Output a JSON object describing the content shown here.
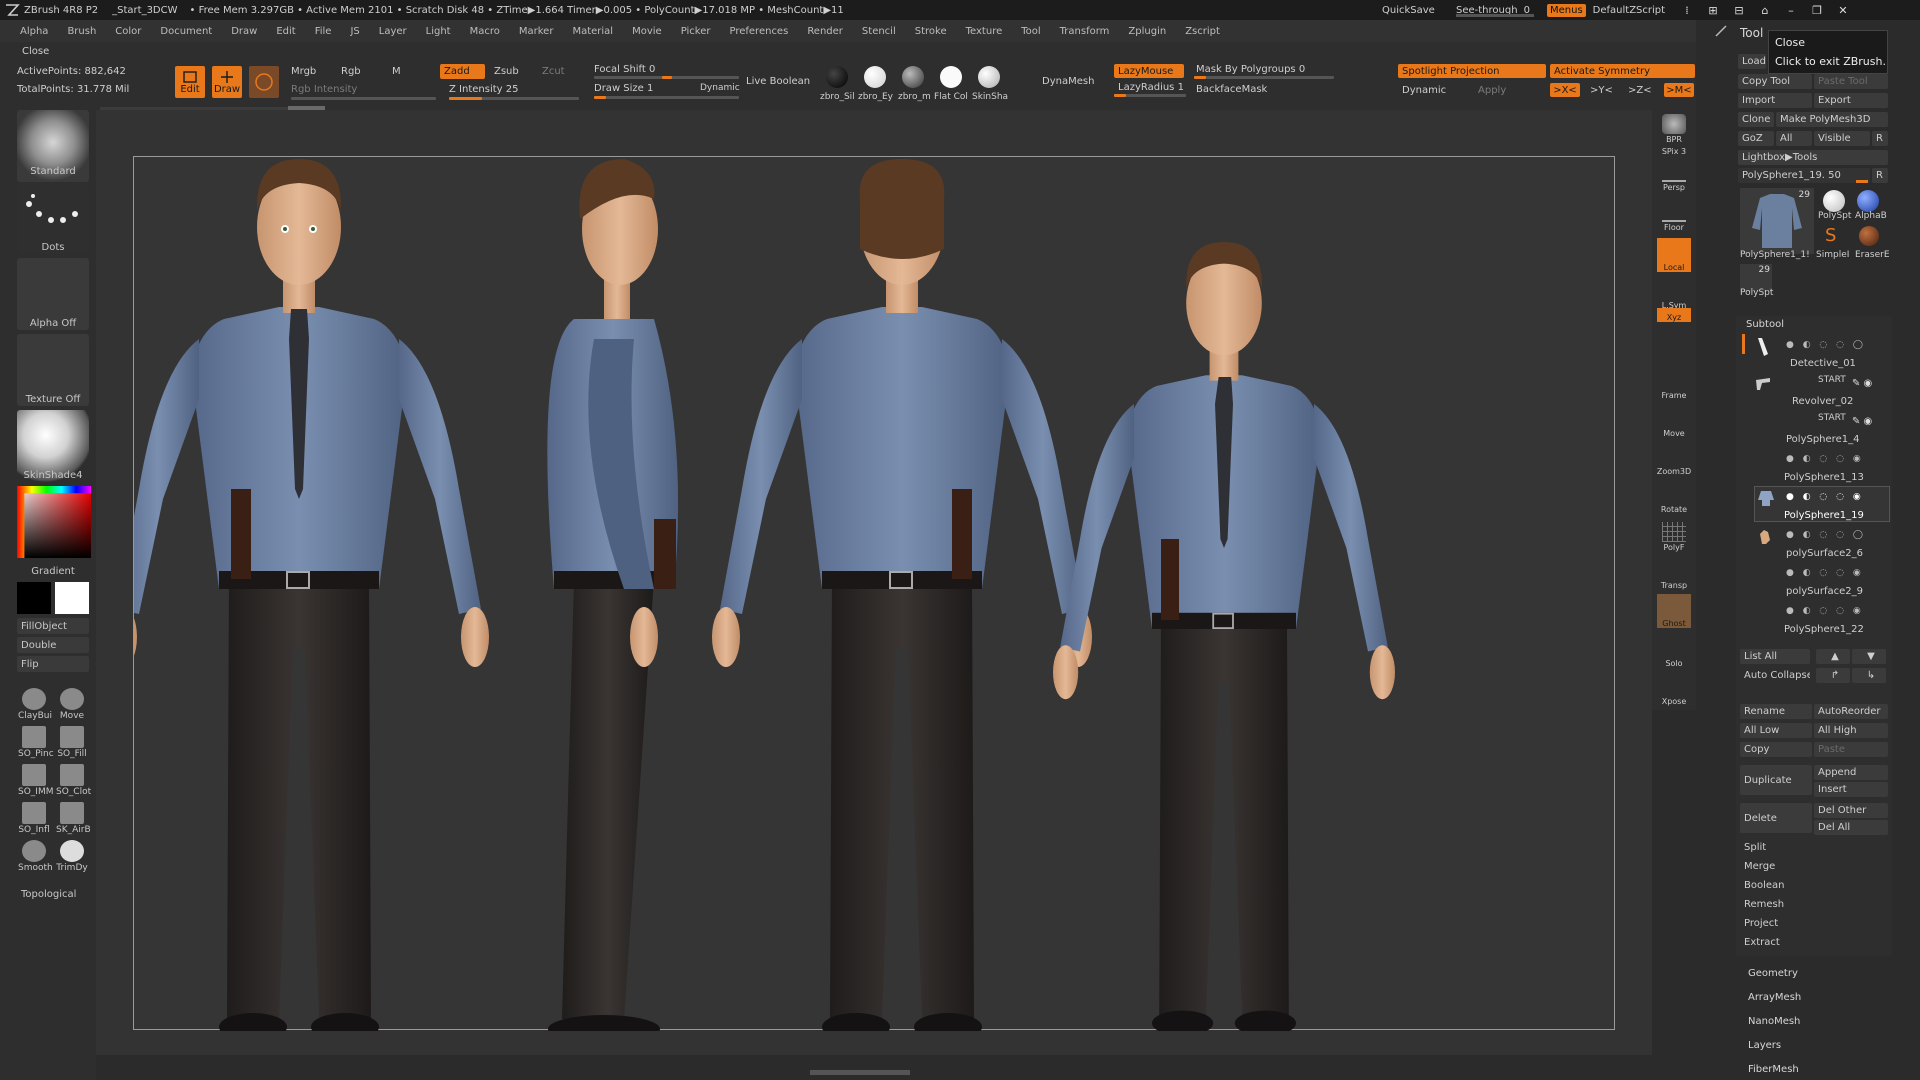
{
  "titlebar": {
    "app": "ZBrush 4R8 P2",
    "document": "_Start_3DCW",
    "stats": "• Free Mem 3.297GB • Active Mem 2101 • Scratch Disk 48 • ZTime▶1.664 Timer▶0.005 • PolyCount▶17.018 MP • MeshCount▶11",
    "quicksave": "QuickSave",
    "see_through_label": "See-through",
    "see_through_value": "0",
    "menus": "Menus",
    "script": "DefaultZScript"
  },
  "menubar": [
    "Alpha",
    "Brush",
    "Color",
    "Document",
    "Draw",
    "Edit",
    "File",
    "JS",
    "Layer",
    "Light",
    "Macro",
    "Marker",
    "Material",
    "Movie",
    "Picker",
    "Preferences",
    "Render",
    "Stencil",
    "Stroke",
    "Texture",
    "Tool",
    "Transform",
    "Zplugin",
    "Zscript"
  ],
  "toolbar": {
    "close": "Close",
    "active_points": "ActivePoints: 882,642",
    "total_points": "TotalPoints: 31.778 Mil",
    "edit": "Edit",
    "draw": "Draw",
    "mrgb": "Mrgb",
    "rgb": "Rgb",
    "m": "M",
    "rgb_intensity": "Rgb Intensity",
    "zadd": "Zadd",
    "zsub": "Zsub",
    "zcut": "Zcut",
    "z_intensity": "Z Intensity 25",
    "z_intensity_value": 25,
    "focal_shift": "Focal Shift 0",
    "draw_size": "Draw Size 1",
    "dynamic": "Dynamic",
    "live_boolean": "Live Boolean",
    "materials": [
      "zbro_Sil",
      "zbro_Ey",
      "zbro_m",
      "Flat Col",
      "SkinSha"
    ],
    "dynamesh": "DynaMesh",
    "lazymouse": "LazyMouse",
    "lazyradius": "LazyRadius 1",
    "mask_by_polygroups": "Mask By Polygroups 0",
    "backface_mask": "BackfaceMask",
    "spotlight_projection": "Spotlight Projection",
    "activate_symmetry": "Activate Symmetry",
    "dynamic2": "Dynamic",
    "apply": "Apply",
    "sym_x": ">X<",
    "sym_y": ">Y<",
    "sym_z": ">Z<",
    "sym_m": ">M<"
  },
  "leftshelf": {
    "brush": "Standard",
    "stroke": "Dots",
    "alpha": "Alpha Off",
    "texture": "Texture Off",
    "material": "SkinShade4",
    "gradient": "Gradient",
    "fill_object": "FillObject",
    "double": "Double",
    "flip": "Flip",
    "brushes": [
      "ClayBui",
      "Move",
      "SO_Pinc",
      "SO_Fill",
      "SO_IMM",
      "SO_Clot",
      "SO_Infl",
      "SK_AirB",
      "Smooth",
      "TrimDy"
    ],
    "topological": "Topological"
  },
  "rightshelf": [
    "BPR",
    "SPix 3",
    "Persp",
    "Floor",
    "Local",
    "L.Sym",
    "Xyz",
    "Frame",
    "Move",
    "Zoom3D",
    "Rotate",
    "PolyF",
    "Transp",
    "Ghost",
    "Solo",
    "Xpose"
  ],
  "tool_panel": {
    "title": "Tool",
    "tooltip_title": "Close",
    "tooltip_text": "Click to exit ZBrush.",
    "load": "Load",
    "copy_tool": "Copy Tool",
    "paste_tool": "Paste Tool",
    "import": "Import",
    "export": "Export",
    "clone": "Clone",
    "make_polymesh": "Make PolyMesh3D",
    "goz": "GoZ",
    "all": "All",
    "visible": "Visible",
    "r": "R",
    "lightbox": "Lightbox▶Tools",
    "current_tool": "PolySphere1_19. 50",
    "tool_count": "29",
    "tools": [
      "PolySphere1_1!",
      "PolySpt",
      "AlphaB",
      "SimpleI",
      "EraserE",
      "PolySpt"
    ],
    "tool_count2": "29"
  },
  "subtool": {
    "title": "Subtool",
    "items": [
      "Detective_01",
      "Revolver_02",
      "PolySphere1_4",
      "PolySphere1_13",
      "PolySphere1_19",
      "polySurface2_6",
      "polySurface2_9",
      "PolySphere1_22"
    ],
    "start_label": "START",
    "list_all": "List All",
    "auto_collapse": "Auto Collapse",
    "rename": "Rename",
    "auto_reorder": "AutoReorder",
    "all_low": "All Low",
    "all_high": "All High",
    "copy": "Copy",
    "paste": "Paste",
    "duplicate": "Duplicate",
    "append": "Append",
    "insert": "Insert",
    "delete": "Delete",
    "del_other": "Del Other",
    "del_all": "Del All",
    "split": "Split",
    "merge": "Merge",
    "boolean": "Boolean",
    "remesh": "Remesh",
    "project": "Project",
    "extract": "Extract"
  },
  "sections": [
    "Geometry",
    "ArrayMesh",
    "NanoMesh",
    "Layers",
    "FiberMesh"
  ],
  "colors": {
    "accent": "#e8781a",
    "shirt": "#6b7f9e",
    "pants": "#2a2624",
    "skin": "#d8a880",
    "hair": "#5a3a22"
  }
}
